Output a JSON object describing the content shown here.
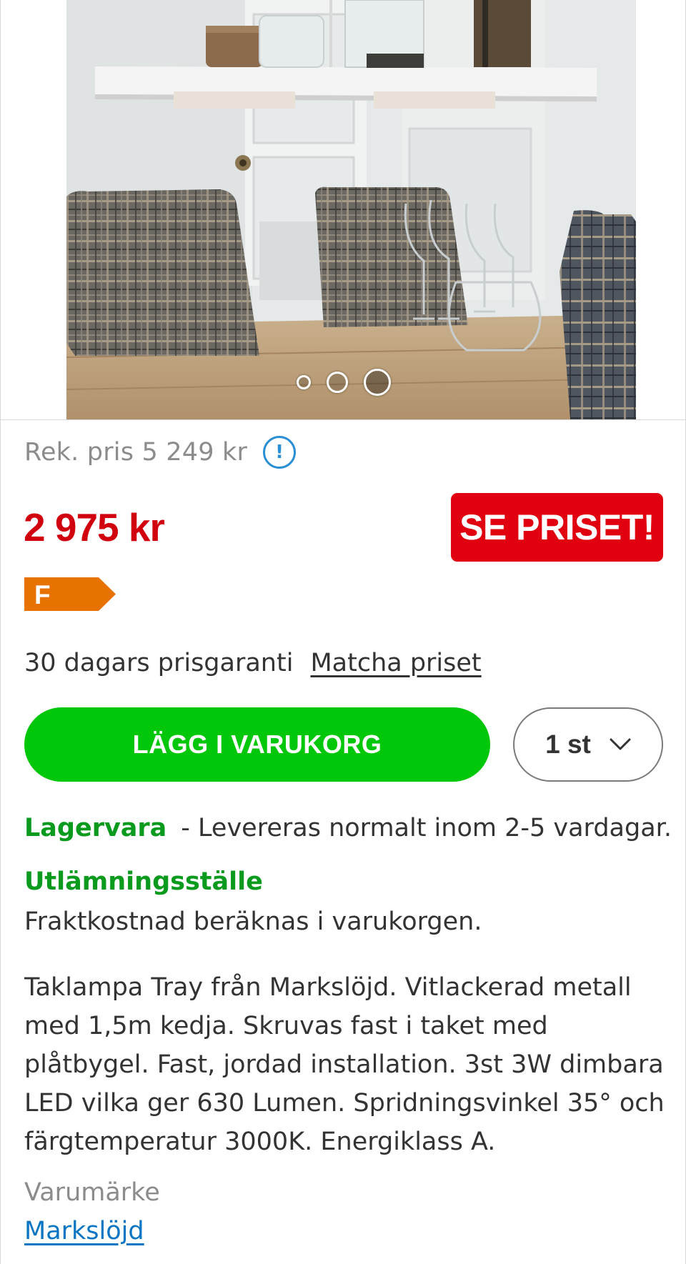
{
  "carousel": {
    "image_alt": "Taklampa Tray över matbord",
    "active_index": 2,
    "total": 3
  },
  "pricing": {
    "rek_price": "Rek. pris 5 249 kr",
    "info_icon": "!",
    "price": "2 975 kr",
    "see_price_button": "SE PRISET!",
    "energy_class": "F",
    "energy_color": "#e87200",
    "price_color": "#d1000f"
  },
  "guarantee": {
    "text": "30 dagars prisgaranti",
    "match_link": "Matcha priset"
  },
  "purchase": {
    "add_to_cart": "LÄGG I VARUKORG",
    "quantity": "1 st",
    "cart_color": "#00c70a"
  },
  "availability": {
    "stock_label": "Lagervara",
    "stock_text": "- Levereras normalt inom 2-5 vardagar.",
    "pickup_title": "Utlämningsställe",
    "shipping_text": "Fraktkostnad beräknas i varukorgen."
  },
  "description": "Taklampa Tray från Markslöjd. Vitlackerad metall med 1,5m kedja. Skruvas fast i taket med plåtbygel. Fast, jordad installation. 3st 3W dimbara LED vilka ger 630 Lumen. Spridningsvinkel 35° och färgtemperatur 3000K. Energiklass A.",
  "brand": {
    "label": "Varumärke",
    "name": "Markslöjd"
  }
}
